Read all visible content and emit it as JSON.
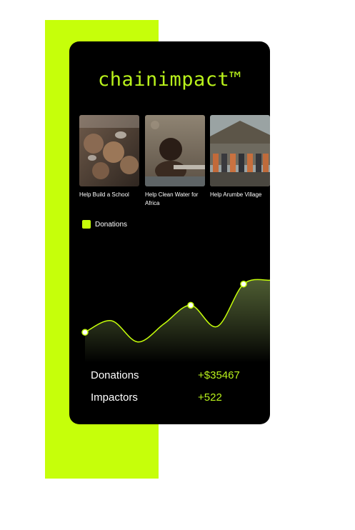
{
  "brand": {
    "name": "chainimpact™"
  },
  "campaigns": [
    {
      "label": "Help Build a School"
    },
    {
      "label": "Help Clean Water for Africa"
    },
    {
      "label": "Help Arumbe Village"
    }
  ],
  "chart_data": {
    "type": "area",
    "legend": "Donations",
    "x": [
      0,
      1,
      2,
      3,
      4,
      5,
      6,
      7
    ],
    "values": [
      28,
      40,
      18,
      37,
      56,
      34,
      78,
      82
    ],
    "marked_points": [
      0,
      4,
      6
    ],
    "ylim": [
      0,
      100
    ],
    "grid": false,
    "colors": {
      "line": "#c6ff0a",
      "fill_top": "#5a6b3a",
      "fill_bottom": "#000000"
    }
  },
  "stats": [
    {
      "label": "Donations",
      "value": "+$35467"
    },
    {
      "label": "Impactors",
      "value": "+522"
    }
  ],
  "colors": {
    "accent": "#c6ff0a",
    "brand_text": "#b9f21b",
    "card_bg": "#000000"
  }
}
